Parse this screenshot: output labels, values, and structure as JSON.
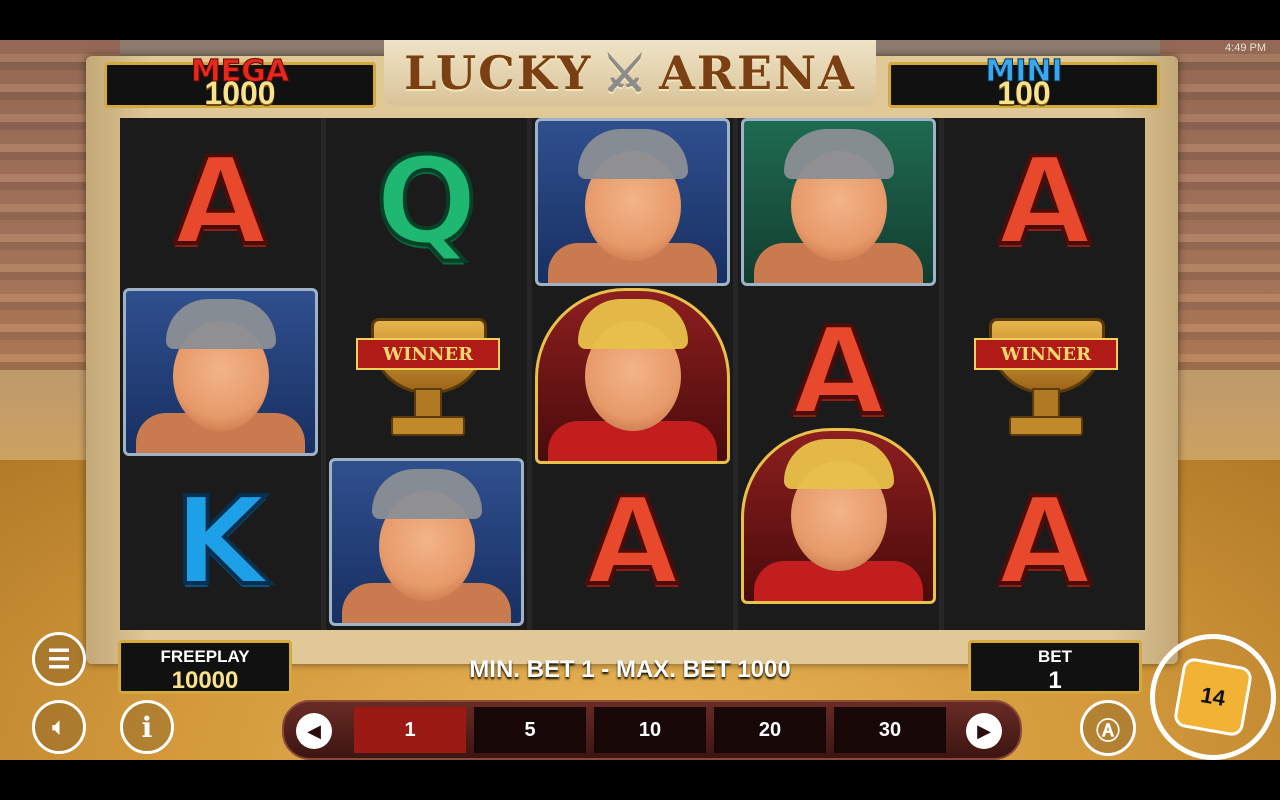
{
  "status_bar": {
    "time": "4:49 PM"
  },
  "game": {
    "title_left": "LUCKY",
    "title_right": "ARENA"
  },
  "jackpots": {
    "mega": {
      "label": "MEGA",
      "value": "1000",
      "color": "#e8281c"
    },
    "mini": {
      "label": "MINI",
      "value": "100",
      "color": "#3aa8f0"
    }
  },
  "reels": [
    {
      "symbols": [
        {
          "kind": "letter",
          "text": "A",
          "name": "symbol-a"
        },
        {
          "kind": "gladiator",
          "name": "symbol-gladiator-spiked"
        },
        {
          "kind": "letter",
          "text": "K",
          "name": "symbol-k"
        }
      ]
    },
    {
      "symbols": [
        {
          "kind": "letter",
          "text": "Q",
          "name": "symbol-q"
        },
        {
          "kind": "trophy",
          "text": "WINNER",
          "name": "symbol-winner-trophy"
        },
        {
          "kind": "gladiator",
          "name": "symbol-gladiator-spiked"
        }
      ]
    },
    {
      "symbols": [
        {
          "kind": "gladiator",
          "name": "symbol-gladiator-helmet"
        },
        {
          "kind": "emperor",
          "name": "symbol-emperor"
        },
        {
          "kind": "letter",
          "text": "A",
          "name": "symbol-a"
        }
      ]
    },
    {
      "symbols": [
        {
          "kind": "brute",
          "name": "symbol-brute-gladiator"
        },
        {
          "kind": "letter",
          "text": "A",
          "name": "symbol-a"
        },
        {
          "kind": "emperor",
          "name": "symbol-emperor"
        }
      ]
    },
    {
      "symbols": [
        {
          "kind": "letter",
          "text": "A",
          "name": "symbol-a"
        },
        {
          "kind": "trophy",
          "text": "WINNER",
          "name": "symbol-winner-trophy"
        },
        {
          "kind": "letter",
          "text": "A",
          "name": "symbol-a"
        }
      ]
    }
  ],
  "freeplay": {
    "label": "FREEPLAY",
    "value": "10000"
  },
  "bet": {
    "label": "BET",
    "value": "1"
  },
  "min_max_text": "MIN. BET 1 - MAX. BET 1000",
  "bet_options": [
    "1",
    "5",
    "10",
    "20",
    "30"
  ],
  "selected_bet": "1",
  "controls": {
    "menu_icon": "menu-icon",
    "sound_icon": "speaker-icon",
    "info_icon": "info-icon",
    "auto_icon": "autoplay-icon",
    "spin_badge": "14"
  }
}
